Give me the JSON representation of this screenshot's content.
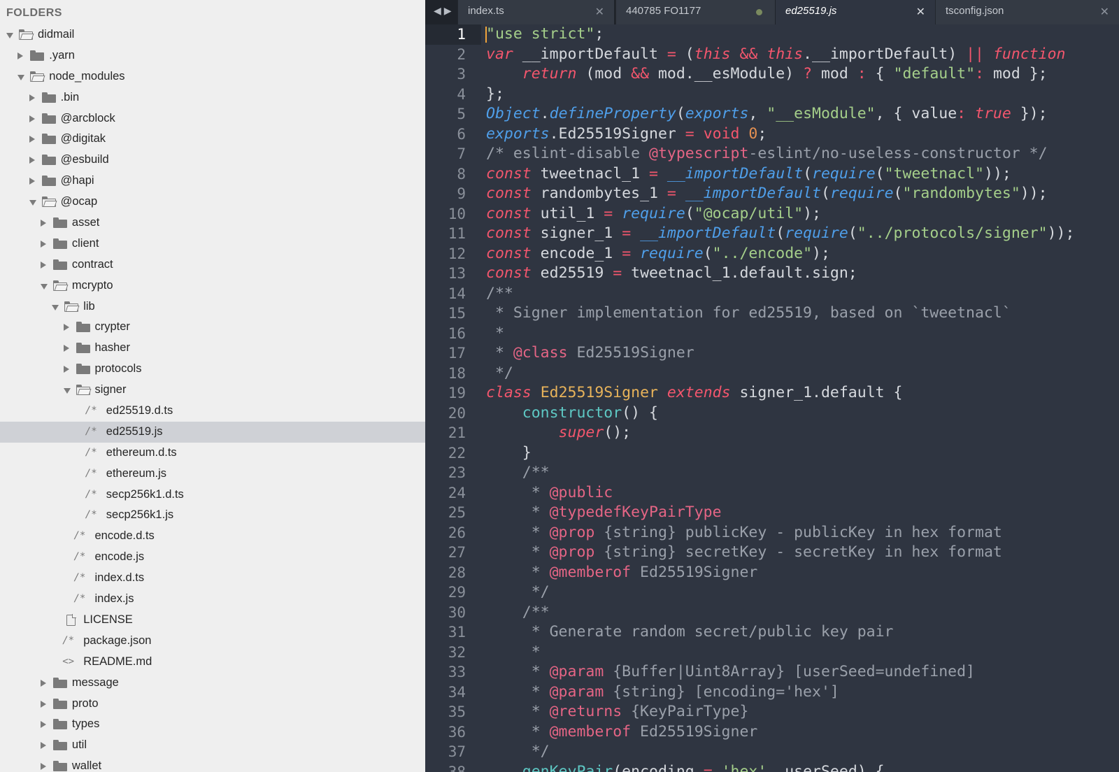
{
  "sidebar": {
    "header": "FOLDERS",
    "items": [
      {
        "label": "didmail",
        "depth": 0,
        "kind": "folder",
        "open": true
      },
      {
        "label": ".yarn",
        "depth": 1,
        "kind": "folder",
        "open": false
      },
      {
        "label": "node_modules",
        "depth": 1,
        "kind": "folder",
        "open": true
      },
      {
        "label": ".bin",
        "depth": 2,
        "kind": "folder",
        "open": false
      },
      {
        "label": "@arcblock",
        "depth": 2,
        "kind": "folder",
        "open": false
      },
      {
        "label": "@digitak",
        "depth": 2,
        "kind": "folder",
        "open": false
      },
      {
        "label": "@esbuild",
        "depth": 2,
        "kind": "folder",
        "open": false
      },
      {
        "label": "@hapi",
        "depth": 2,
        "kind": "folder",
        "open": false
      },
      {
        "label": "@ocap",
        "depth": 2,
        "kind": "folder",
        "open": true
      },
      {
        "label": "asset",
        "depth": 3,
        "kind": "folder",
        "open": false
      },
      {
        "label": "client",
        "depth": 3,
        "kind": "folder",
        "open": false
      },
      {
        "label": "contract",
        "depth": 3,
        "kind": "folder",
        "open": false
      },
      {
        "label": "mcrypto",
        "depth": 3,
        "kind": "folder",
        "open": true
      },
      {
        "label": "lib",
        "depth": 4,
        "kind": "folder",
        "open": true
      },
      {
        "label": "crypter",
        "depth": 5,
        "kind": "folder",
        "open": false
      },
      {
        "label": "hasher",
        "depth": 5,
        "kind": "folder",
        "open": false
      },
      {
        "label": "protocols",
        "depth": 5,
        "kind": "folder",
        "open": false
      },
      {
        "label": "signer",
        "depth": 5,
        "kind": "folder",
        "open": true
      },
      {
        "label": "ed25519.d.ts",
        "depth": 6,
        "kind": "code"
      },
      {
        "label": "ed25519.js",
        "depth": 6,
        "kind": "code",
        "selected": true
      },
      {
        "label": "ethereum.d.ts",
        "depth": 6,
        "kind": "code"
      },
      {
        "label": "ethereum.js",
        "depth": 6,
        "kind": "code"
      },
      {
        "label": "secp256k1.d.ts",
        "depth": 6,
        "kind": "code"
      },
      {
        "label": "secp256k1.js",
        "depth": 6,
        "kind": "code"
      },
      {
        "label": "encode.d.ts",
        "depth": 5,
        "kind": "code"
      },
      {
        "label": "encode.js",
        "depth": 5,
        "kind": "code"
      },
      {
        "label": "index.d.ts",
        "depth": 5,
        "kind": "code"
      },
      {
        "label": "index.js",
        "depth": 5,
        "kind": "code"
      },
      {
        "label": "LICENSE",
        "depth": 4,
        "kind": "doc"
      },
      {
        "label": "package.json",
        "depth": 4,
        "kind": "code"
      },
      {
        "label": "README.md",
        "depth": 4,
        "kind": "markup"
      },
      {
        "label": "message",
        "depth": 3,
        "kind": "folder",
        "open": false
      },
      {
        "label": "proto",
        "depth": 3,
        "kind": "folder",
        "open": false
      },
      {
        "label": "types",
        "depth": 3,
        "kind": "folder",
        "open": false
      },
      {
        "label": "util",
        "depth": 3,
        "kind": "folder",
        "open": false
      },
      {
        "label": "wallet",
        "depth": 3,
        "kind": "folder",
        "open": false
      }
    ]
  },
  "tabs": [
    {
      "label": "index.ts",
      "state": "inactive",
      "indicator": "close"
    },
    {
      "label": "440785   FO1177",
      "state": "inactive",
      "indicator": "dot"
    },
    {
      "label": "ed25519.js",
      "state": "active",
      "indicator": "close"
    },
    {
      "label": "tsconfig.json",
      "state": "inactive",
      "indicator": "close"
    }
  ],
  "nav": {
    "back": "◀",
    "forward": "▶"
  },
  "editor": {
    "current_line": 1,
    "lines": [
      "\"use strict\";",
      "var __importDefault = (this && this.__importDefault) || function",
      "    return (mod && mod.__esModule) ? mod : { \"default\": mod };",
      "};",
      "Object.defineProperty(exports, \"__esModule\", { value: true });",
      "exports.Ed25519Signer = void 0;",
      "/* eslint-disable @typescript-eslint/no-useless-constructor */",
      "const tweetnacl_1 = __importDefault(require(\"tweetnacl\"));",
      "const randombytes_1 = __importDefault(require(\"randombytes\"));",
      "const util_1 = require(\"@ocap/util\");",
      "const signer_1 = __importDefault(require(\"../protocols/signer\"));",
      "const encode_1 = require(\"../encode\");",
      "const ed25519 = tweetnacl_1.default.sign;",
      "/**",
      " * Signer implementation for ed25519, based on `tweetnacl`",
      " *",
      " * @class Ed25519Signer",
      " */",
      "class Ed25519Signer extends signer_1.default {",
      "    constructor() {",
      "        super();",
      "    }",
      "    /**",
      "     * @public",
      "     * @typedefKeyPairType",
      "     * @prop {string} publicKey - publicKey in hex format",
      "     * @prop {string} secretKey - secretKey in hex format",
      "     * @memberof Ed25519Signer",
      "     */",
      "    /**",
      "     * Generate random secret/public key pair",
      "     *",
      "     * @param {Buffer|Uint8Array} [userSeed=undefined]",
      "     * @param {string} [encoding='hex']",
      "     * @returns {KeyPairType}",
      "     * @memberof Ed25519Signer",
      "     */",
      "    genKeyPair(encoding = 'hex', userSeed) {"
    ]
  }
}
